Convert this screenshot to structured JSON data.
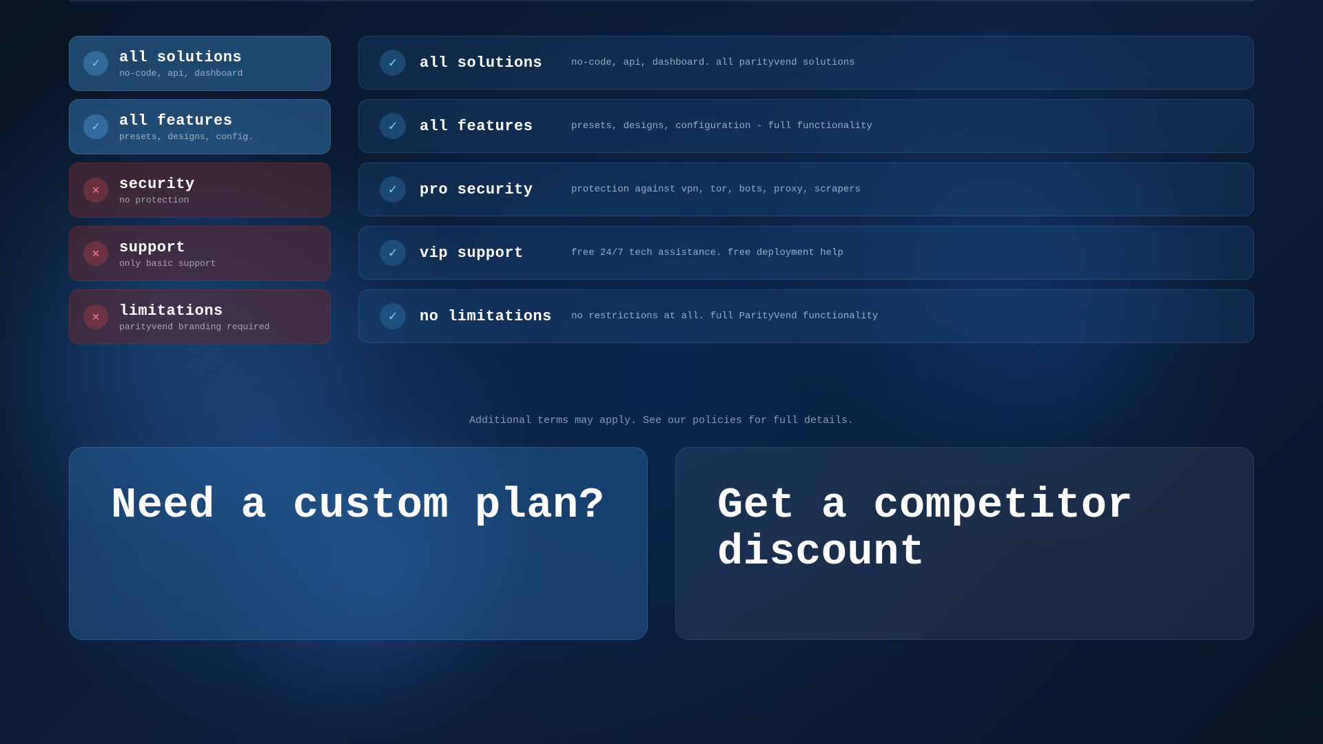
{
  "background": {
    "color": "#0a1a2e"
  },
  "left_panel": {
    "items": [
      {
        "id": "all-solutions",
        "type": "active",
        "title": "all solutions",
        "subtitle": "no-code, api, dashboard",
        "icon": "check"
      },
      {
        "id": "all-features",
        "type": "active",
        "title": "all features",
        "subtitle": "presets, designs, config.",
        "icon": "check"
      },
      {
        "id": "security",
        "type": "inactive",
        "title": "security",
        "subtitle": "no protection",
        "icon": "x"
      },
      {
        "id": "support",
        "type": "inactive",
        "title": "support",
        "subtitle": "only basic support",
        "icon": "x"
      },
      {
        "id": "limitations",
        "type": "inactive",
        "title": "limitations",
        "subtitle": "parityvend branding required",
        "icon": "x"
      }
    ]
  },
  "right_panel": {
    "items": [
      {
        "id": "all-solutions",
        "title": "all solutions",
        "description": "no-code, api, dashboard. all parityvend solutions",
        "icon": "check"
      },
      {
        "id": "all-features",
        "title": "all features",
        "description": "presets, designs, configuration - full functionality",
        "icon": "check"
      },
      {
        "id": "pro-security",
        "title": "pro security",
        "description": "protection against vpn, tor, bots, proxy, scrapers",
        "icon": "check"
      },
      {
        "id": "vip-support",
        "title": "vip support",
        "description": "free 24/7 tech assistance. free deployment help",
        "icon": "check"
      },
      {
        "id": "no-limitations",
        "title": "no limitations",
        "description": "no restrictions at all. full ParityVend functionality",
        "icon": "check"
      }
    ]
  },
  "additional_terms": "Additional terms may apply. See our policies for full details.",
  "bottom_cards": {
    "custom_plan": {
      "title": "Need a custom plan?",
      "type": "custom-plan"
    },
    "competitor_discount": {
      "title": "Get a competitor discount",
      "type": "competitor-discount"
    }
  }
}
